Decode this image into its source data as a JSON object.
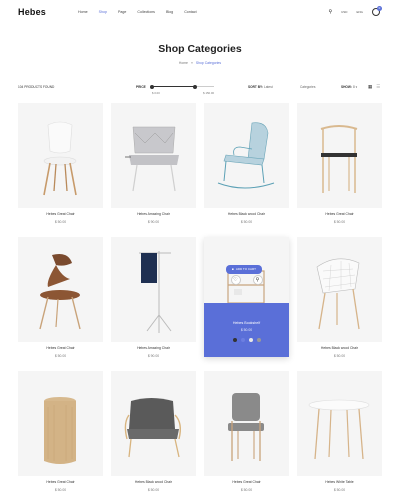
{
  "header": {
    "logo": "Hebes",
    "nav": [
      "Home",
      "Shop",
      "Page",
      "Collections",
      "Blog",
      "Contact"
    ],
    "active_nav": "Shop",
    "currency": "USD",
    "language": "ENG",
    "cart_count": "0"
  },
  "page": {
    "title": "Shop Categories",
    "breadcrumb": [
      "Home",
      "Shop Categories"
    ]
  },
  "filters": {
    "count": "104 PRODUCTS FOUND",
    "price_label": "PRICE",
    "price_min": "$ 0.00",
    "price_max": "$ 150.00",
    "price_range_fraction": [
      0.0,
      0.7
    ],
    "sort_label": "SORT BY:",
    "sort_value": "Latest",
    "category_label": "Categories",
    "show_label": "SHOW:",
    "show_value": "8 ▾"
  },
  "products": [
    {
      "name": "Hebes Great Chair",
      "price": "$ 50.00"
    },
    {
      "name": "Hebes Amazing Chair",
      "price": "$ 90.00"
    },
    {
      "name": "Hebes Black wood Chair",
      "price": "$ 50.00"
    },
    {
      "name": "Hebes Great Chair",
      "price": "$ 50.00"
    },
    {
      "name": "Hebes Great Chair",
      "price": "$ 50.00"
    },
    {
      "name": "Hebes Amazing Chair",
      "price": "$ 90.00"
    },
    {
      "name": "Hebes Bookshelf",
      "price": "$ 50.00"
    },
    {
      "name": "Hebes Black wood Chair",
      "price": "$ 50.00"
    },
    {
      "name": "Hebes Great Chair",
      "price": "$ 50.00"
    },
    {
      "name": "Hebes Black wood Chair",
      "price": "$ 50.00"
    },
    {
      "name": "Hebes Great Chair",
      "price": "$ 50.00"
    },
    {
      "name": "Hebes White Table",
      "price": "$ 50.00"
    }
  ],
  "hover": {
    "button": "ADD TO CART",
    "name": "Hebes Bookshelf",
    "price": "$ 50.00",
    "swatches": [
      "#333333",
      "#6c7ee0",
      "#e8e8e8",
      "#999999"
    ]
  },
  "colors": {
    "accent": "#5a6fd8",
    "card_bg": "#f5f5f5"
  }
}
